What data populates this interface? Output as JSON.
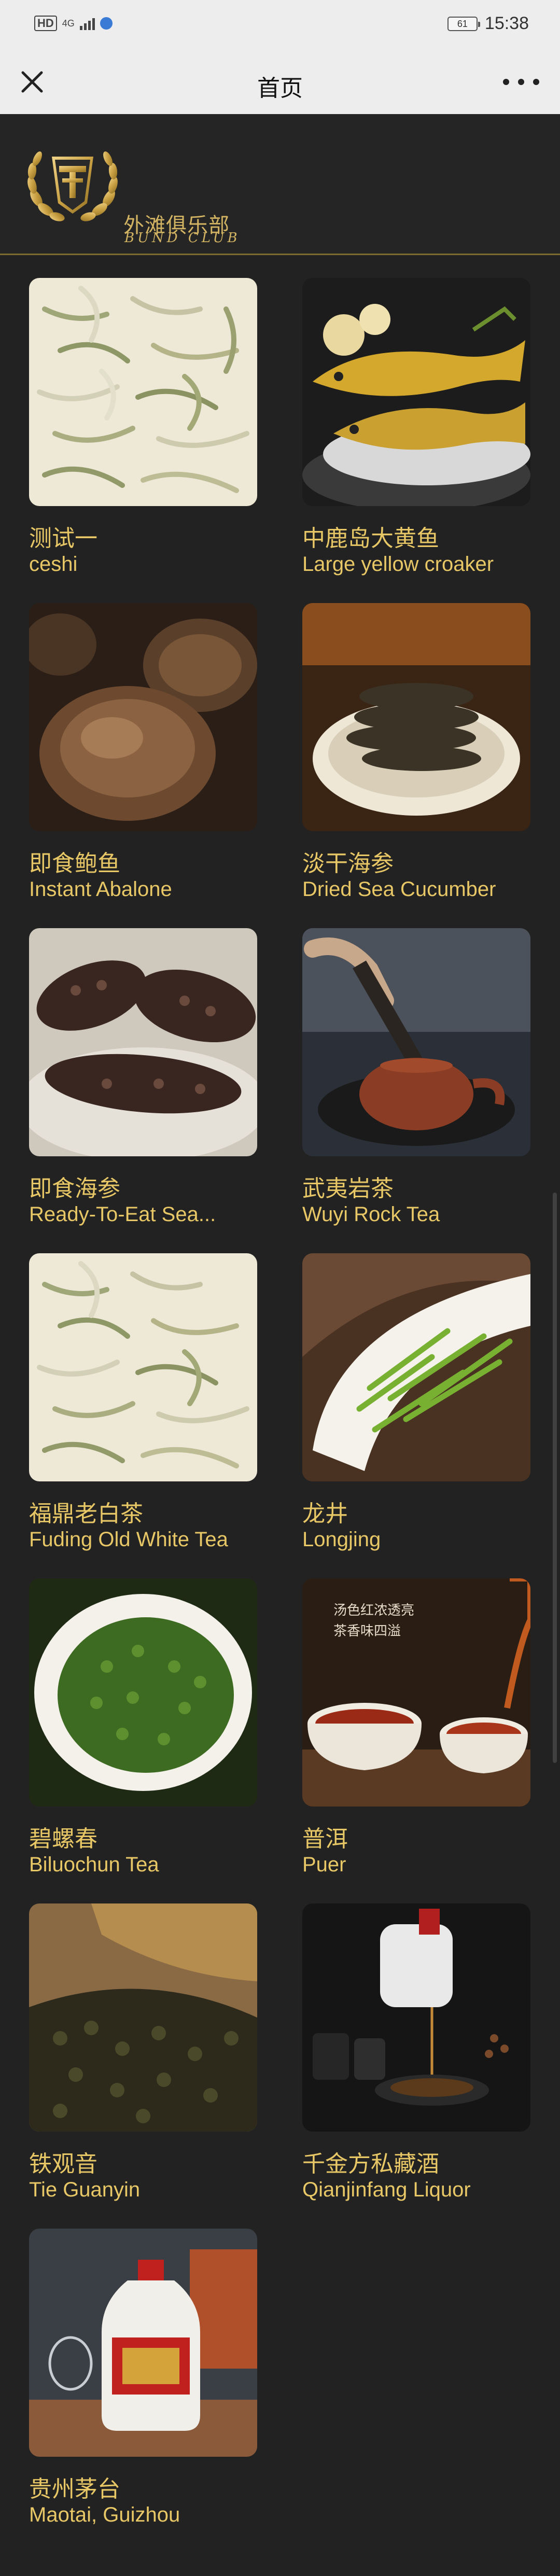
{
  "status_bar": {
    "hd": "HD",
    "network": "4G",
    "battery": "61",
    "time": "15:38"
  },
  "title_bar": {
    "title": "首页",
    "close_icon": "close-icon",
    "more_icon": "more-icon"
  },
  "header": {
    "logo_cn": "外滩俱乐部",
    "logo_en": "BUND CLUB"
  },
  "products": [
    {
      "name_cn": "测试一",
      "name_en": "ceshi"
    },
    {
      "name_cn": "中鹿岛大黄鱼",
      "name_en": "Large yellow croaker"
    },
    {
      "name_cn": "即食鲍鱼",
      "name_en": "Instant Abalone"
    },
    {
      "name_cn": "淡干海参",
      "name_en": "Dried Sea Cucumber"
    },
    {
      "name_cn": "即食海参",
      "name_en": "Ready-To-Eat Sea..."
    },
    {
      "name_cn": "武夷岩茶",
      "name_en": "Wuyi Rock Tea"
    },
    {
      "name_cn": "福鼎老白茶",
      "name_en": "Fuding Old White Tea"
    },
    {
      "name_cn": "龙井",
      "name_en": "Longjing"
    },
    {
      "name_cn": "碧螺春",
      "name_en": "Biluochun Tea"
    },
    {
      "name_cn": "普洱",
      "name_en": "Puer"
    },
    {
      "name_cn": "铁观音",
      "name_en": "Tie Guanyin"
    },
    {
      "name_cn": "千金方私藏酒",
      "name_en": "Qianjinfang Liquor"
    },
    {
      "name_cn": "贵州茅台",
      "name_en": "Maotai, Guizhou"
    }
  ]
}
